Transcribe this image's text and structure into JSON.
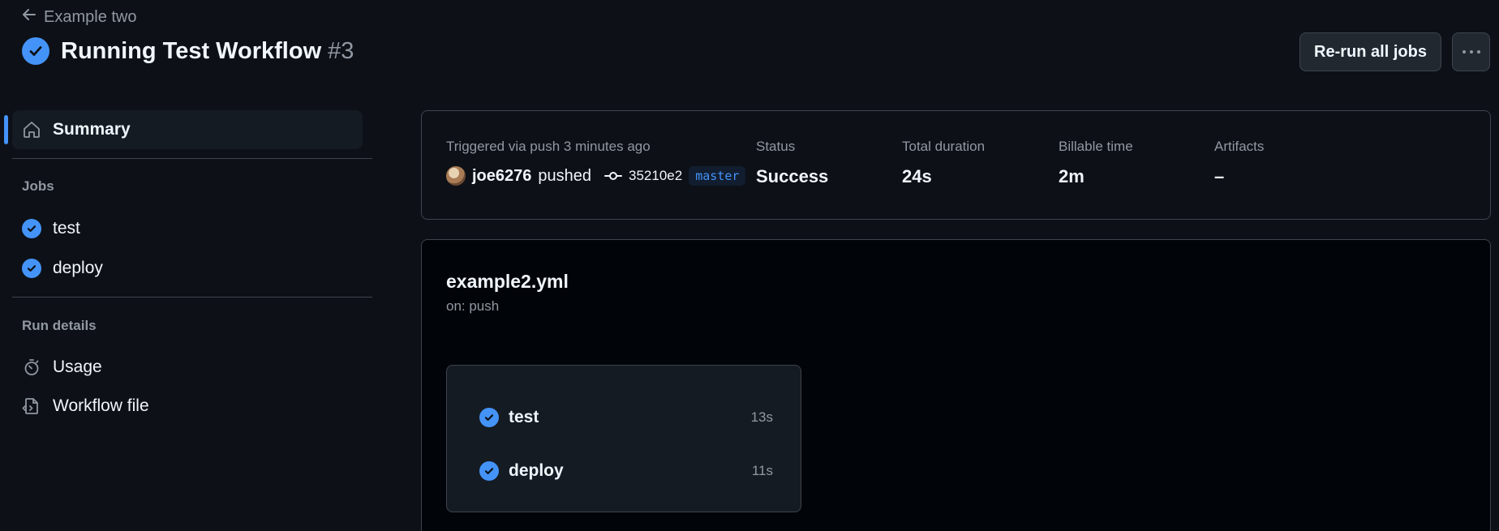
{
  "header": {
    "back_label": "Example two",
    "title": "Running Test Workflow",
    "run_number": "#3",
    "rerun_label": "Re-run all jobs"
  },
  "sidebar": {
    "summary_label": "Summary",
    "jobs_heading": "Jobs",
    "jobs": [
      {
        "label": "test",
        "status": "success"
      },
      {
        "label": "deploy",
        "status": "success"
      }
    ],
    "run_details_heading": "Run details",
    "details": [
      {
        "label": "Usage",
        "icon": "stopwatch-icon"
      },
      {
        "label": "Workflow file",
        "icon": "file-code-icon"
      }
    ]
  },
  "summary": {
    "trigger_label": "Triggered via push 3 minutes ago",
    "user": "joe6276",
    "action": "pushed",
    "commit_sha": "35210e2",
    "branch": "master",
    "status_label": "Status",
    "status_value": "Success",
    "duration_label": "Total duration",
    "duration_value": "24s",
    "billable_label": "Billable time",
    "billable_value": "2m",
    "artifacts_label": "Artifacts",
    "artifacts_value": "–"
  },
  "workflow": {
    "file_name": "example2.yml",
    "trigger": "on: push",
    "jobs": [
      {
        "label": "test",
        "duration": "13s"
      },
      {
        "label": "deploy",
        "duration": "11s"
      }
    ]
  },
  "colors": {
    "background": "#0d1117",
    "accent": "#4493f8",
    "border": "#3d444d",
    "muted": "#9198a1"
  }
}
